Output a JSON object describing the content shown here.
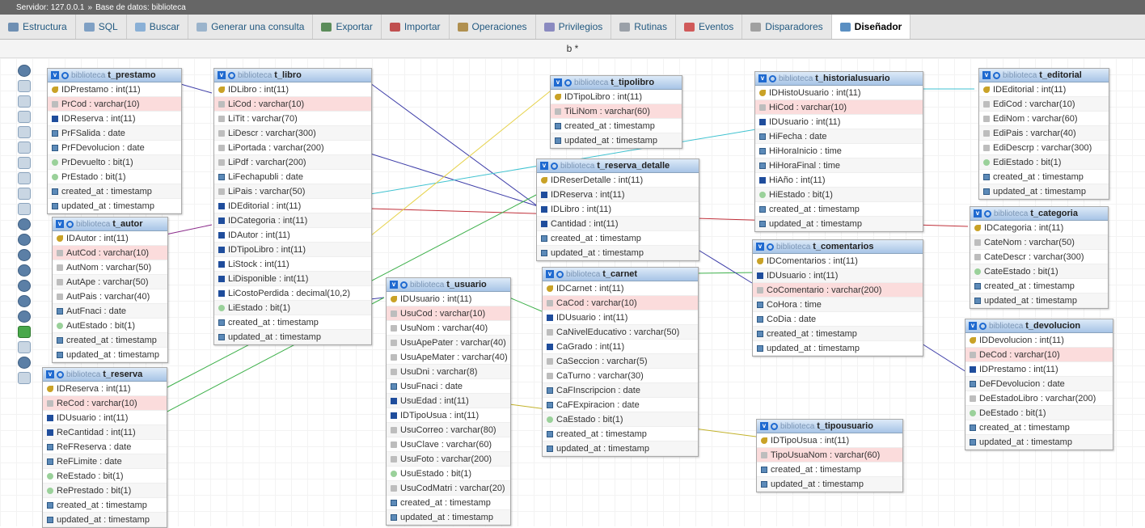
{
  "breadcrumb": {
    "server": "Servidor: 127.0.0.1",
    "sep": "»",
    "database": "Base de datos: biblioteca"
  },
  "tabs": [
    {
      "label": "Estructura",
      "icon": "structure-icon"
    },
    {
      "label": "SQL",
      "icon": "sql-icon"
    },
    {
      "label": "Buscar",
      "icon": "search-icon"
    },
    {
      "label": "Generar una consulta",
      "icon": "query-icon"
    },
    {
      "label": "Exportar",
      "icon": "export-icon"
    },
    {
      "label": "Importar",
      "icon": "import-icon"
    },
    {
      "label": "Operaciones",
      "icon": "wrench-icon"
    },
    {
      "label": "Privilegios",
      "icon": "privileges-icon"
    },
    {
      "label": "Rutinas",
      "icon": "routines-icon"
    },
    {
      "label": "Eventos",
      "icon": "clock-icon"
    },
    {
      "label": "Disparadores",
      "icon": "trigger-icon"
    },
    {
      "label": "Diseñador",
      "icon": "designer-icon"
    }
  ],
  "designer_title": "b *",
  "db": "biblioteca",
  "tables": [
    {
      "id": "t_prestamo",
      "name": "t_prestamo",
      "cols": [
        {
          "t": "key",
          "n": "IDPrestamo : int(11)"
        },
        {
          "t": "str",
          "n": "PrCod : varchar(10)",
          "pk": true
        },
        {
          "t": "num",
          "n": "IDReserva : int(11)"
        },
        {
          "t": "dt",
          "n": "PrFSalida : date"
        },
        {
          "t": "dt",
          "n": "PrFDevolucion : date"
        },
        {
          "t": "bit",
          "n": "PrDevuelto : bit(1)"
        },
        {
          "t": "bit",
          "n": "PrEstado : bit(1)"
        },
        {
          "t": "dt",
          "n": "created_at : timestamp"
        },
        {
          "t": "dt",
          "n": "updated_at : timestamp"
        }
      ]
    },
    {
      "id": "t_libro",
      "name": "t_libro",
      "cols": [
        {
          "t": "key",
          "n": "IDLibro : int(11)"
        },
        {
          "t": "str",
          "n": "LiCod : varchar(10)",
          "pk": true
        },
        {
          "t": "str",
          "n": "LiTit : varchar(70)"
        },
        {
          "t": "str",
          "n": "LiDescr : varchar(300)"
        },
        {
          "t": "str",
          "n": "LiPortada : varchar(200)"
        },
        {
          "t": "str",
          "n": "LiPdf : varchar(200)"
        },
        {
          "t": "dt",
          "n": "LiFechapubli : date"
        },
        {
          "t": "str",
          "n": "LiPais : varchar(50)"
        },
        {
          "t": "num",
          "n": "IDEditorial : int(11)"
        },
        {
          "t": "num",
          "n": "IDCategoria : int(11)"
        },
        {
          "t": "num",
          "n": "IDAutor : int(11)"
        },
        {
          "t": "num",
          "n": "IDTipoLibro : int(11)"
        },
        {
          "t": "num",
          "n": "LiStock : int(11)"
        },
        {
          "t": "num",
          "n": "LiDisponible : int(11)"
        },
        {
          "t": "num",
          "n": "LiCostoPerdida : decimal(10,2)"
        },
        {
          "t": "bit",
          "n": "LiEstado : bit(1)"
        },
        {
          "t": "dt",
          "n": "created_at : timestamp"
        },
        {
          "t": "dt",
          "n": "updated_at : timestamp"
        }
      ]
    },
    {
      "id": "t_autor",
      "name": "t_autor",
      "cols": [
        {
          "t": "key",
          "n": "IDAutor : int(11)"
        },
        {
          "t": "str",
          "n": "AutCod : varchar(10)",
          "pk": true
        },
        {
          "t": "str",
          "n": "AutNom : varchar(50)"
        },
        {
          "t": "str",
          "n": "AutApe : varchar(50)"
        },
        {
          "t": "str",
          "n": "AutPais : varchar(40)"
        },
        {
          "t": "dt",
          "n": "AutFnaci : date"
        },
        {
          "t": "bit",
          "n": "AutEstado : bit(1)"
        },
        {
          "t": "dt",
          "n": "created_at : timestamp"
        },
        {
          "t": "dt",
          "n": "updated_at : timestamp"
        }
      ]
    },
    {
      "id": "t_reserva",
      "name": "t_reserva",
      "cols": [
        {
          "t": "key",
          "n": "IDReserva : int(11)"
        },
        {
          "t": "str",
          "n": "ReCod : varchar(10)",
          "pk": true
        },
        {
          "t": "num",
          "n": "IDUsuario : int(11)"
        },
        {
          "t": "num",
          "n": "ReCantidad : int(11)"
        },
        {
          "t": "dt",
          "n": "ReFReserva : date"
        },
        {
          "t": "dt",
          "n": "ReFLimite : date"
        },
        {
          "t": "bit",
          "n": "ReEstado : bit(1)"
        },
        {
          "t": "bit",
          "n": "RePrestado : bit(1)"
        },
        {
          "t": "dt",
          "n": "created_at : timestamp"
        },
        {
          "t": "dt",
          "n": "updated_at : timestamp"
        }
      ]
    },
    {
      "id": "t_tipolibro",
      "name": "t_tipolibro",
      "cols": [
        {
          "t": "key",
          "n": "IDTipoLibro : int(11)"
        },
        {
          "t": "str",
          "n": "TiLiNom : varchar(60)",
          "pk": true
        },
        {
          "t": "dt",
          "n": "created_at : timestamp"
        },
        {
          "t": "dt",
          "n": "updated_at : timestamp"
        }
      ]
    },
    {
      "id": "t_reserva_detalle",
      "name": "t_reserva_detalle",
      "cols": [
        {
          "t": "key",
          "n": "IDReserDetalle : int(11)"
        },
        {
          "t": "num",
          "n": "IDReserva : int(11)"
        },
        {
          "t": "num",
          "n": "IDLibro : int(11)"
        },
        {
          "t": "num",
          "n": "Cantidad : int(11)"
        },
        {
          "t": "dt",
          "n": "created_at : timestamp"
        },
        {
          "t": "dt",
          "n": "updated_at : timestamp"
        }
      ]
    },
    {
      "id": "t_usuario",
      "name": "t_usuario",
      "cols": [
        {
          "t": "key",
          "n": "IDUsuario : int(11)"
        },
        {
          "t": "str",
          "n": "UsuCod : varchar(10)",
          "pk": true
        },
        {
          "t": "str",
          "n": "UsuNom : varchar(40)"
        },
        {
          "t": "str",
          "n": "UsuApePater : varchar(40)"
        },
        {
          "t": "str",
          "n": "UsuApeMater : varchar(40)"
        },
        {
          "t": "str",
          "n": "UsuDni : varchar(8)"
        },
        {
          "t": "dt",
          "n": "UsuFnaci : date"
        },
        {
          "t": "num",
          "n": "UsuEdad : int(11)"
        },
        {
          "t": "num",
          "n": "IDTipoUsua : int(11)"
        },
        {
          "t": "str",
          "n": "UsuCorreo : varchar(80)"
        },
        {
          "t": "str",
          "n": "UsuClave : varchar(60)"
        },
        {
          "t": "str",
          "n": "UsuFoto : varchar(200)"
        },
        {
          "t": "bit",
          "n": "UsuEstado : bit(1)"
        },
        {
          "t": "str",
          "n": "UsuCodMatri : varchar(20)"
        },
        {
          "t": "dt",
          "n": "created_at : timestamp"
        },
        {
          "t": "dt",
          "n": "updated_at : timestamp"
        }
      ]
    },
    {
      "id": "t_carnet",
      "name": "t_carnet",
      "cols": [
        {
          "t": "key",
          "n": "IDCarnet : int(11)"
        },
        {
          "t": "str",
          "n": "CaCod : varchar(10)",
          "pk": true
        },
        {
          "t": "num",
          "n": "IDUsuario : int(11)"
        },
        {
          "t": "str",
          "n": "CaNivelEducativo : varchar(50)"
        },
        {
          "t": "num",
          "n": "CaGrado : int(11)"
        },
        {
          "t": "str",
          "n": "CaSeccion : varchar(5)"
        },
        {
          "t": "str",
          "n": "CaTurno : varchar(30)"
        },
        {
          "t": "dt",
          "n": "CaFInscripcion : date"
        },
        {
          "t": "dt",
          "n": "CaFExpiracion : date"
        },
        {
          "t": "bit",
          "n": "CaEstado : bit(1)"
        },
        {
          "t": "dt",
          "n": "created_at : timestamp"
        },
        {
          "t": "dt",
          "n": "updated_at : timestamp"
        }
      ]
    },
    {
      "id": "t_historialusuario",
      "name": "t_historialusuario",
      "cols": [
        {
          "t": "key",
          "n": "IDHistoUsuario : int(11)"
        },
        {
          "t": "str",
          "n": "HiCod : varchar(10)",
          "pk": true
        },
        {
          "t": "num",
          "n": "IDUsuario : int(11)"
        },
        {
          "t": "dt",
          "n": "HiFecha : date"
        },
        {
          "t": "dt",
          "n": "HiHoraInicio : time"
        },
        {
          "t": "dt",
          "n": "HiHoraFinal : time"
        },
        {
          "t": "num",
          "n": "HiAño : int(11)"
        },
        {
          "t": "bit",
          "n": "HiEstado : bit(1)"
        },
        {
          "t": "dt",
          "n": "created_at : timestamp"
        },
        {
          "t": "dt",
          "n": "updated_at : timestamp"
        }
      ]
    },
    {
      "id": "t_comentarios",
      "name": "t_comentarios",
      "cols": [
        {
          "t": "key",
          "n": "IDComentarios : int(11)"
        },
        {
          "t": "num",
          "n": "IDUsuario : int(11)"
        },
        {
          "t": "str",
          "n": "CoComentario : varchar(200)",
          "pk": true
        },
        {
          "t": "dt",
          "n": "CoHora : time"
        },
        {
          "t": "dt",
          "n": "CoDia : date"
        },
        {
          "t": "dt",
          "n": "created_at : timestamp"
        },
        {
          "t": "dt",
          "n": "updated_at : timestamp"
        }
      ]
    },
    {
      "id": "t_tipousuario",
      "name": "t_tipousuario",
      "cols": [
        {
          "t": "key",
          "n": "IDTipoUsua : int(11)"
        },
        {
          "t": "str",
          "n": "TipoUsuaNom : varchar(60)",
          "pk": true
        },
        {
          "t": "dt",
          "n": "created_at : timestamp"
        },
        {
          "t": "dt",
          "n": "updated_at : timestamp"
        }
      ]
    },
    {
      "id": "t_editorial",
      "name": "t_editorial",
      "cols": [
        {
          "t": "key",
          "n": "IDEditorial : int(11)"
        },
        {
          "t": "str",
          "n": "EdiCod : varchar(10)"
        },
        {
          "t": "str",
          "n": "EdiNom : varchar(60)"
        },
        {
          "t": "str",
          "n": "EdiPais : varchar(40)"
        },
        {
          "t": "str",
          "n": "EdiDescrp : varchar(300)"
        },
        {
          "t": "bit",
          "n": "EdiEstado : bit(1)"
        },
        {
          "t": "dt",
          "n": "created_at : timestamp"
        },
        {
          "t": "dt",
          "n": "updated_at : timestamp"
        }
      ]
    },
    {
      "id": "t_categoria",
      "name": "t_categoria",
      "cols": [
        {
          "t": "key",
          "n": "IDCategoria : int(11)"
        },
        {
          "t": "str",
          "n": "CateNom : varchar(50)"
        },
        {
          "t": "str",
          "n": "CateDescr : varchar(300)"
        },
        {
          "t": "bit",
          "n": "CateEstado : bit(1)"
        },
        {
          "t": "dt",
          "n": "created_at : timestamp"
        },
        {
          "t": "dt",
          "n": "updated_at : timestamp"
        }
      ]
    },
    {
      "id": "t_devolucion",
      "name": "t_devolucion",
      "cols": [
        {
          "t": "key",
          "n": "IDDevolucion : int(11)"
        },
        {
          "t": "str",
          "n": "DeCod : varchar(10)",
          "pk": true
        },
        {
          "t": "num",
          "n": "IDPrestamo : int(11)"
        },
        {
          "t": "dt",
          "n": "DeFDevolucion : date"
        },
        {
          "t": "str",
          "n": "DeEstadoLibro : varchar(200)"
        },
        {
          "t": "bit",
          "n": "DeEstado : bit(1)"
        },
        {
          "t": "dt",
          "n": "created_at : timestamp"
        },
        {
          "t": "dt",
          "n": "updated_at : timestamp"
        }
      ]
    }
  ]
}
